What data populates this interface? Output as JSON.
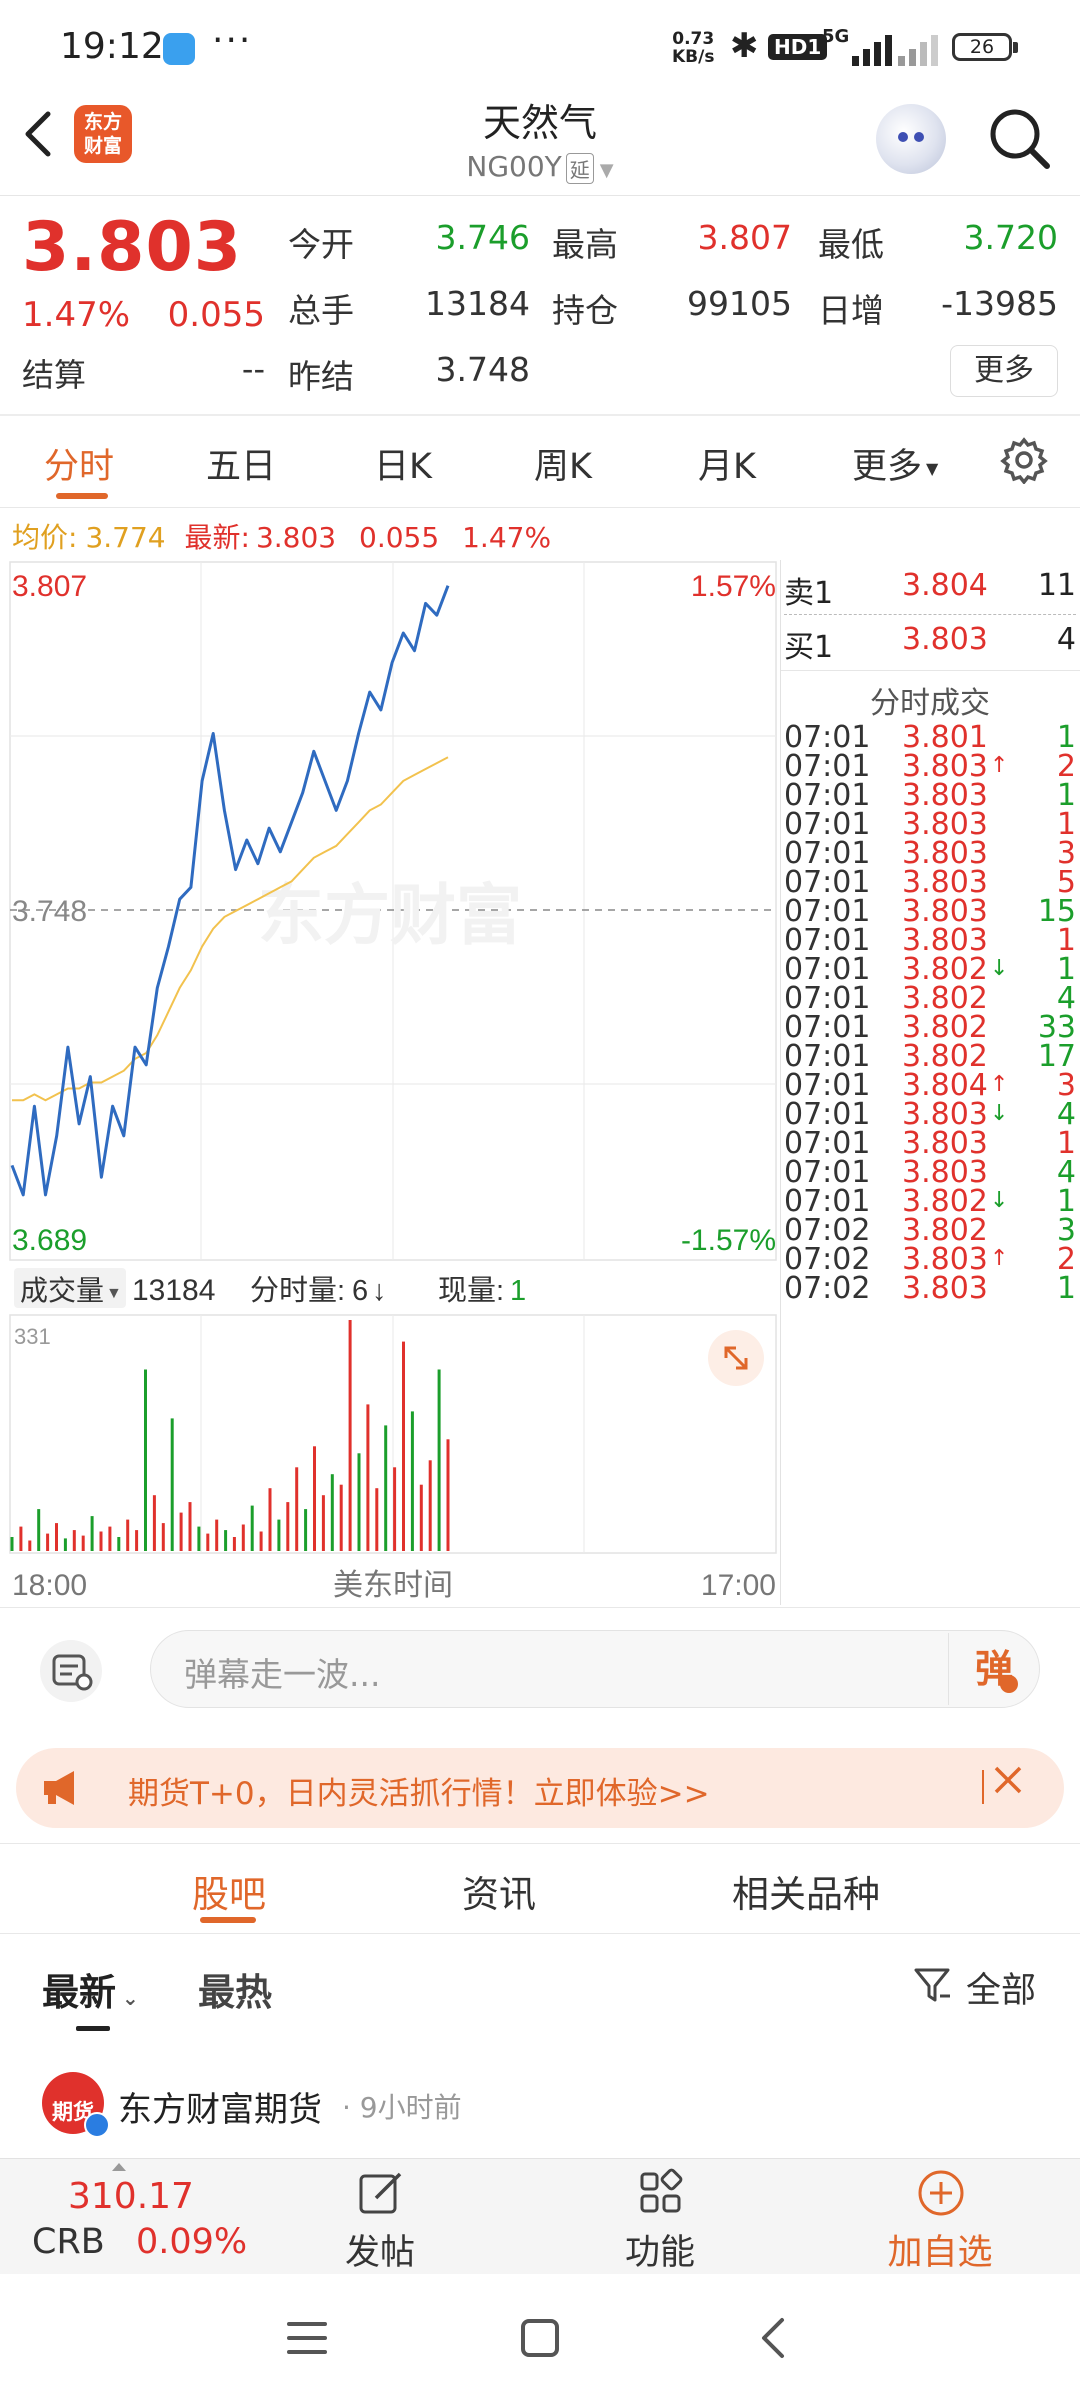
{
  "status_bar": {
    "time": "19:12",
    "dots": "···",
    "net_speed": "0.73",
    "net_speed_unit": "KB/s",
    "hd": "HD1",
    "network": "5G",
    "battery": "26"
  },
  "header": {
    "logo_text": "东方财富",
    "title": "天然气",
    "subtitle": "NG00Y",
    "subtitle_badge": "延"
  },
  "quote": {
    "price": "3.803",
    "change_pct": "1.47%",
    "change": "0.055",
    "settle_label": "结算",
    "settle_value": "--",
    "open_label": "今开",
    "open_value": "3.746",
    "high_label": "最高",
    "high_value": "3.807",
    "low_label": "最低",
    "low_value": "3.720",
    "volume_label": "总手",
    "volume_value": "13184",
    "oi_label": "持仓",
    "oi_value": "99105",
    "daily_inc_label": "日增",
    "daily_inc_value": "-13985",
    "prev_settle_label": "昨结",
    "prev_settle_value": "3.748",
    "more_button": "更多"
  },
  "chart_tabs": [
    "分时",
    "五日",
    "日K",
    "周K",
    "月K",
    "更多"
  ],
  "avg_line": {
    "avg_label": "均价:",
    "avg_value": "3.774",
    "latest_label": "最新:",
    "latest_value": "3.803",
    "change": "0.055",
    "change_pct": "1.47%"
  },
  "chart_labels": {
    "high_price": "3.807",
    "low_price": "3.689",
    "high_pct": "1.57%",
    "low_pct": "-1.57%",
    "ref_price": "3.748",
    "volume_selector": "成交量",
    "volume_total": "13184",
    "tick_volume_label": "分时量:",
    "tick_volume_value": "6",
    "current_volume_label": "现量:",
    "current_volume_value": "1",
    "volume_scale": "331",
    "time_start": "18:00",
    "time_mid": "美东时间",
    "time_end": "17:00",
    "watermark": "东方财富"
  },
  "chart_data": {
    "type": "line",
    "title": "",
    "xlabel": "美东时间",
    "ylabel": "",
    "x_range": [
      "18:00",
      "17:00"
    ],
    "ylim": [
      3.689,
      3.807
    ],
    "reference": 3.748,
    "series": [
      {
        "name": "最新",
        "color": "#2f6bc0",
        "values": [
          3.705,
          3.7,
          3.715,
          3.7,
          3.71,
          3.725,
          3.712,
          3.72,
          3.703,
          3.715,
          3.71,
          3.725,
          3.722,
          3.735,
          3.742,
          3.75,
          3.752,
          3.77,
          3.778,
          3.765,
          3.755,
          3.76,
          3.756,
          3.762,
          3.758,
          3.763,
          3.768,
          3.775,
          3.77,
          3.765,
          3.77,
          3.778,
          3.785,
          3.782,
          3.79,
          3.795,
          3.792,
          3.8,
          3.798,
          3.803
        ]
      },
      {
        "name": "均价",
        "color": "#f2c24e",
        "values": [
          3.716,
          3.716,
          3.717,
          3.716,
          3.717,
          3.718,
          3.718,
          3.719,
          3.719,
          3.72,
          3.721,
          3.723,
          3.724,
          3.727,
          3.731,
          3.735,
          3.738,
          3.742,
          3.745,
          3.747,
          3.748,
          3.749,
          3.75,
          3.751,
          3.752,
          3.753,
          3.755,
          3.757,
          3.758,
          3.759,
          3.761,
          3.763,
          3.765,
          3.766,
          3.768,
          3.77,
          3.771,
          3.772,
          3.773,
          3.774
        ]
      }
    ],
    "volume": [
      20,
      35,
      15,
      60,
      25,
      40,
      18,
      30,
      22,
      50,
      28,
      35,
      20,
      45,
      30,
      260,
      80,
      40,
      190,
      55,
      70,
      35,
      25,
      45,
      30,
      20,
      38,
      65,
      28,
      90,
      45,
      70,
      120,
      60,
      150,
      80,
      110,
      95,
      331,
      140,
      210,
      90,
      180,
      120,
      300,
      200,
      95,
      130,
      260,
      160
    ],
    "grid": true
  },
  "trade_panel": {
    "ask_label": "卖1",
    "ask_price": "3.804",
    "ask_qty": "11",
    "bid_label": "买1",
    "bid_price": "3.803",
    "bid_qty": "4",
    "section_title": "分时成交",
    "ticks": [
      {
        "time": "07:01",
        "price": "3.801",
        "arrow": "",
        "qty": "1",
        "qty_color": "green"
      },
      {
        "time": "07:01",
        "price": "3.803",
        "arrow": "↑",
        "qty": "2",
        "qty_color": "red"
      },
      {
        "time": "07:01",
        "price": "3.803",
        "arrow": "",
        "qty": "1",
        "qty_color": "green"
      },
      {
        "time": "07:01",
        "price": "3.803",
        "arrow": "",
        "qty": "1",
        "qty_color": "red"
      },
      {
        "time": "07:01",
        "price": "3.803",
        "arrow": "",
        "qty": "3",
        "qty_color": "red"
      },
      {
        "time": "07:01",
        "price": "3.803",
        "arrow": "",
        "qty": "5",
        "qty_color": "red"
      },
      {
        "time": "07:01",
        "price": "3.803",
        "arrow": "",
        "qty": "15",
        "qty_color": "green"
      },
      {
        "time": "07:01",
        "price": "3.803",
        "arrow": "",
        "qty": "1",
        "qty_color": "red"
      },
      {
        "time": "07:01",
        "price": "3.802",
        "arrow": "↓",
        "qty": "1",
        "qty_color": "green"
      },
      {
        "time": "07:01",
        "price": "3.802",
        "arrow": "",
        "qty": "4",
        "qty_color": "green"
      },
      {
        "time": "07:01",
        "price": "3.802",
        "arrow": "",
        "qty": "33",
        "qty_color": "green"
      },
      {
        "time": "07:01",
        "price": "3.802",
        "arrow": "",
        "qty": "17",
        "qty_color": "green"
      },
      {
        "time": "07:01",
        "price": "3.804",
        "arrow": "↑",
        "qty": "3",
        "qty_color": "red"
      },
      {
        "time": "07:01",
        "price": "3.803",
        "arrow": "↓",
        "qty": "4",
        "qty_color": "green"
      },
      {
        "time": "07:01",
        "price": "3.803",
        "arrow": "",
        "qty": "1",
        "qty_color": "red"
      },
      {
        "time": "07:01",
        "price": "3.803",
        "arrow": "",
        "qty": "4",
        "qty_color": "green"
      },
      {
        "time": "07:01",
        "price": "3.802",
        "arrow": "↓",
        "qty": "1",
        "qty_color": "green"
      },
      {
        "time": "07:02",
        "price": "3.802",
        "arrow": "",
        "qty": "3",
        "qty_color": "green"
      },
      {
        "time": "07:02",
        "price": "3.803",
        "arrow": "↑",
        "qty": "2",
        "qty_color": "red"
      },
      {
        "time": "07:02",
        "price": "3.803",
        "arrow": "",
        "qty": "1",
        "qty_color": "green"
      }
    ]
  },
  "comment_bar": {
    "placeholder": "弹幕走一波...",
    "send_label": "弹"
  },
  "promo": {
    "text": "期货T+0，日内灵活抓行情！立即体验>>",
    "close_icon": "close-icon"
  },
  "community_tabs": [
    "股吧",
    "资讯",
    "相关品种"
  ],
  "filter_tabs": [
    "最新",
    "最热"
  ],
  "filter_all": "全部",
  "post": {
    "avatar_text": "期货",
    "author": "东方财富期货",
    "time": "· 9小时前"
  },
  "bottom_nav": {
    "crb_value": "310.17",
    "crb_label": "CRB",
    "crb_pct": "0.09%",
    "post_label": "发帖",
    "func_label": "功能",
    "watch_label": "加自选"
  },
  "colors": {
    "accent": "#e0672a",
    "up": "#e0312c",
    "down": "#1b9e2b",
    "price_line": "#2f6bc0",
    "avg_line": "#f2c24e"
  }
}
